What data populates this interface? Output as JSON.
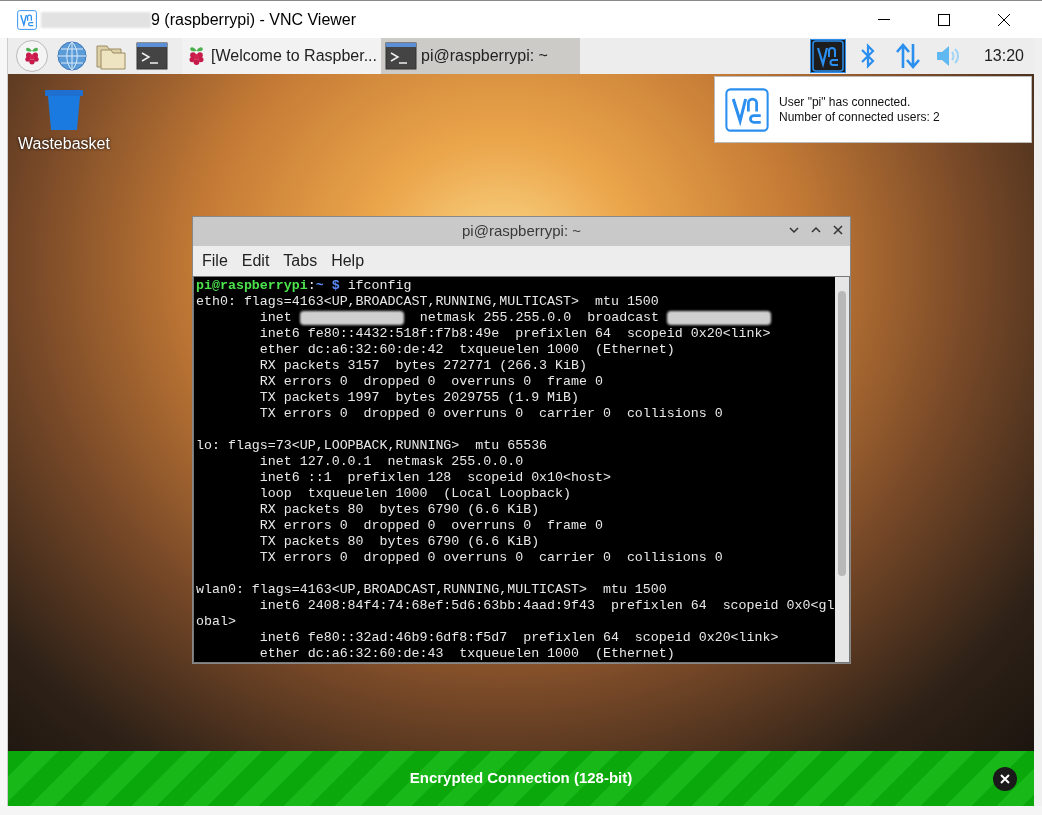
{
  "window": {
    "title": "9 (raspberrypi) - VNC Viewer",
    "title_redacted": true
  },
  "taskbar": {
    "launchers": [
      {
        "kind": "raspberry"
      },
      {
        "kind": "globe"
      },
      {
        "kind": "folder"
      },
      {
        "kind": "terminal"
      }
    ],
    "tasks": [
      {
        "kind": "raspberry",
        "label": "[Welcome to Raspber...",
        "selected": false
      },
      {
        "kind": "terminal",
        "label": "pi@raspberrypi: ~",
        "selected": true
      }
    ],
    "tray": [
      {
        "kind": "vnc",
        "selected": true
      },
      {
        "kind": "bluetooth",
        "selected": false
      },
      {
        "kind": "network",
        "selected": false
      },
      {
        "kind": "volume",
        "selected": false
      }
    ],
    "clock": "13:20"
  },
  "notification": {
    "lines": [
      "User \"pi\" has connected.",
      "Number of connected users: 2"
    ]
  },
  "desktop_icons": [
    {
      "label": "Wastebasket"
    }
  ],
  "terminal": {
    "title": "pi@raspberrypi: ~",
    "menu": [
      "File",
      "Edit",
      "Tabs",
      "Help"
    ],
    "lines": [
      [
        {
          "kind": "user",
          "text": "pi@raspberrypi"
        },
        {
          "kind": "text",
          "text": ":"
        },
        {
          "kind": "path",
          "text": "~ $"
        },
        {
          "kind": "text",
          "text": " ifconfig"
        }
      ],
      [
        {
          "kind": "text",
          "text": "eth0: flags=4163<UP,BROADCAST,RUNNING,MULTICAST>  mtu 1500"
        }
      ],
      [
        {
          "kind": "text",
          "text": "        inet "
        },
        {
          "kind": "redacted"
        },
        {
          "kind": "text",
          "text": "  netmask 255.255.0.0  broadcast "
        },
        {
          "kind": "redacted"
        }
      ],
      [
        {
          "kind": "text",
          "text": "        inet6 fe80::4432:518f:f7b8:49e  prefixlen 64  scopeid 0x20<link>"
        }
      ],
      [
        {
          "kind": "text",
          "text": "        ether dc:a6:32:60:de:42  txqueuelen 1000  (Ethernet)"
        }
      ],
      [
        {
          "kind": "text",
          "text": "        RX packets 3157  bytes 272771 (266.3 KiB)"
        }
      ],
      [
        {
          "kind": "text",
          "text": "        RX errors 0  dropped 0  overruns 0  frame 0"
        }
      ],
      [
        {
          "kind": "text",
          "text": "        TX packets 1997  bytes 2029755 (1.9 MiB)"
        }
      ],
      [
        {
          "kind": "text",
          "text": "        TX errors 0  dropped 0 overruns 0  carrier 0  collisions 0"
        }
      ],
      [
        {
          "kind": "blank"
        }
      ],
      [
        {
          "kind": "text",
          "text": "lo: flags=73<UP,LOOPBACK,RUNNING>  mtu 65536"
        }
      ],
      [
        {
          "kind": "text",
          "text": "        inet 127.0.0.1  netmask 255.0.0.0"
        }
      ],
      [
        {
          "kind": "text",
          "text": "        inet6 ::1  prefixlen 128  scopeid 0x10<host>"
        }
      ],
      [
        {
          "kind": "text",
          "text": "        loop  txqueuelen 1000  (Local Loopback)"
        }
      ],
      [
        {
          "kind": "text",
          "text": "        RX packets 80  bytes 6790 (6.6 KiB)"
        }
      ],
      [
        {
          "kind": "text",
          "text": "        RX errors 0  dropped 0  overruns 0  frame 0"
        }
      ],
      [
        {
          "kind": "text",
          "text": "        TX packets 80  bytes 6790 (6.6 KiB)"
        }
      ],
      [
        {
          "kind": "text",
          "text": "        TX errors 0  dropped 0 overruns 0  carrier 0  collisions 0"
        }
      ],
      [
        {
          "kind": "blank"
        }
      ],
      [
        {
          "kind": "text",
          "text": "wlan0: flags=4163<UP,BROADCAST,RUNNING,MULTICAST>  mtu 1500"
        }
      ],
      [
        {
          "kind": "text",
          "text": "        inet6 2408:84f4:74:68ef:5d6:63bb:4aad:9f43  prefixlen 64  scopeid 0x0<gl"
        }
      ],
      [
        {
          "kind": "text",
          "text": "obal>"
        }
      ],
      [
        {
          "kind": "text",
          "text": "        inet6 fe80::32ad:46b9:6df8:f5d7  prefixlen 64  scopeid 0x20<link>"
        }
      ],
      [
        {
          "kind": "text",
          "text": "        ether dc:a6:32:60:de:43  txqueuelen 1000  (Ethernet)"
        }
      ]
    ]
  },
  "banner": {
    "text": "Encrypted Connection (128-bit)"
  }
}
